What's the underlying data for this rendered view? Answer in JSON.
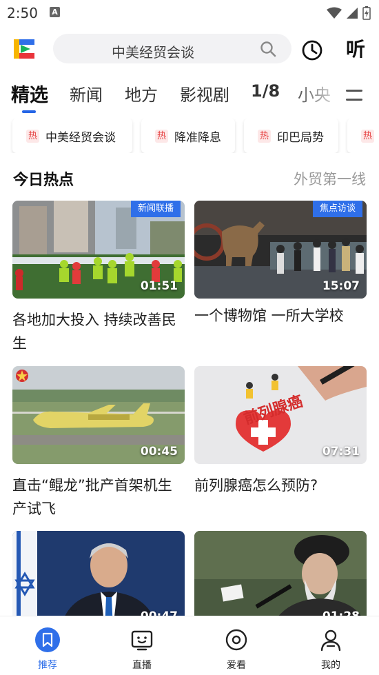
{
  "status": {
    "time": "2:50",
    "notification_glyph": "A"
  },
  "header": {
    "search_text": "中美经贸会谈",
    "listen_label": "听"
  },
  "tabs": [
    {
      "label": "精选",
      "active": true
    },
    {
      "label": "新闻"
    },
    {
      "label": "地方"
    },
    {
      "label": "影视剧"
    },
    {
      "label": "1/8"
    },
    {
      "label": "小央"
    }
  ],
  "hot_chips": [
    {
      "badge": "热",
      "label": "中美经贸会谈"
    },
    {
      "badge": "热",
      "label": "降准降息"
    },
    {
      "badge": "热",
      "label": "印巴局势"
    },
    {
      "badge": "热",
      "label": ""
    }
  ],
  "section": {
    "title": "今日热点",
    "more": "外贸第一线"
  },
  "cards": [
    {
      "tag": "新闻联播",
      "duration": "01:51",
      "title": "各地加大投入 持续改善民生"
    },
    {
      "tag": "焦点访谈",
      "duration": "15:07",
      "title": "一个博物馆 一所大学校"
    },
    {
      "tag": "",
      "duration": "00:45",
      "title": "直击“鲲龙”批产首架机生产试飞"
    },
    {
      "tag": "",
      "duration": "07:31",
      "title": "前列腺癌怎么预防?",
      "thumb_text": "前列腺癌"
    },
    {
      "tag": "",
      "duration": "00:47",
      "title": ""
    },
    {
      "tag": "",
      "duration": "01:28",
      "title": ""
    }
  ],
  "bottom_nav": [
    {
      "label": "推荐",
      "icon": "bookmark-icon",
      "active": true
    },
    {
      "label": "直播",
      "icon": "tv-icon"
    },
    {
      "label": "爱看",
      "icon": "target-icon"
    },
    {
      "label": "我的",
      "icon": "person-icon"
    }
  ],
  "colors": {
    "accent": "#2f6fe9",
    "hot_badge": "#e53b3b",
    "muted_text": "#999999"
  }
}
